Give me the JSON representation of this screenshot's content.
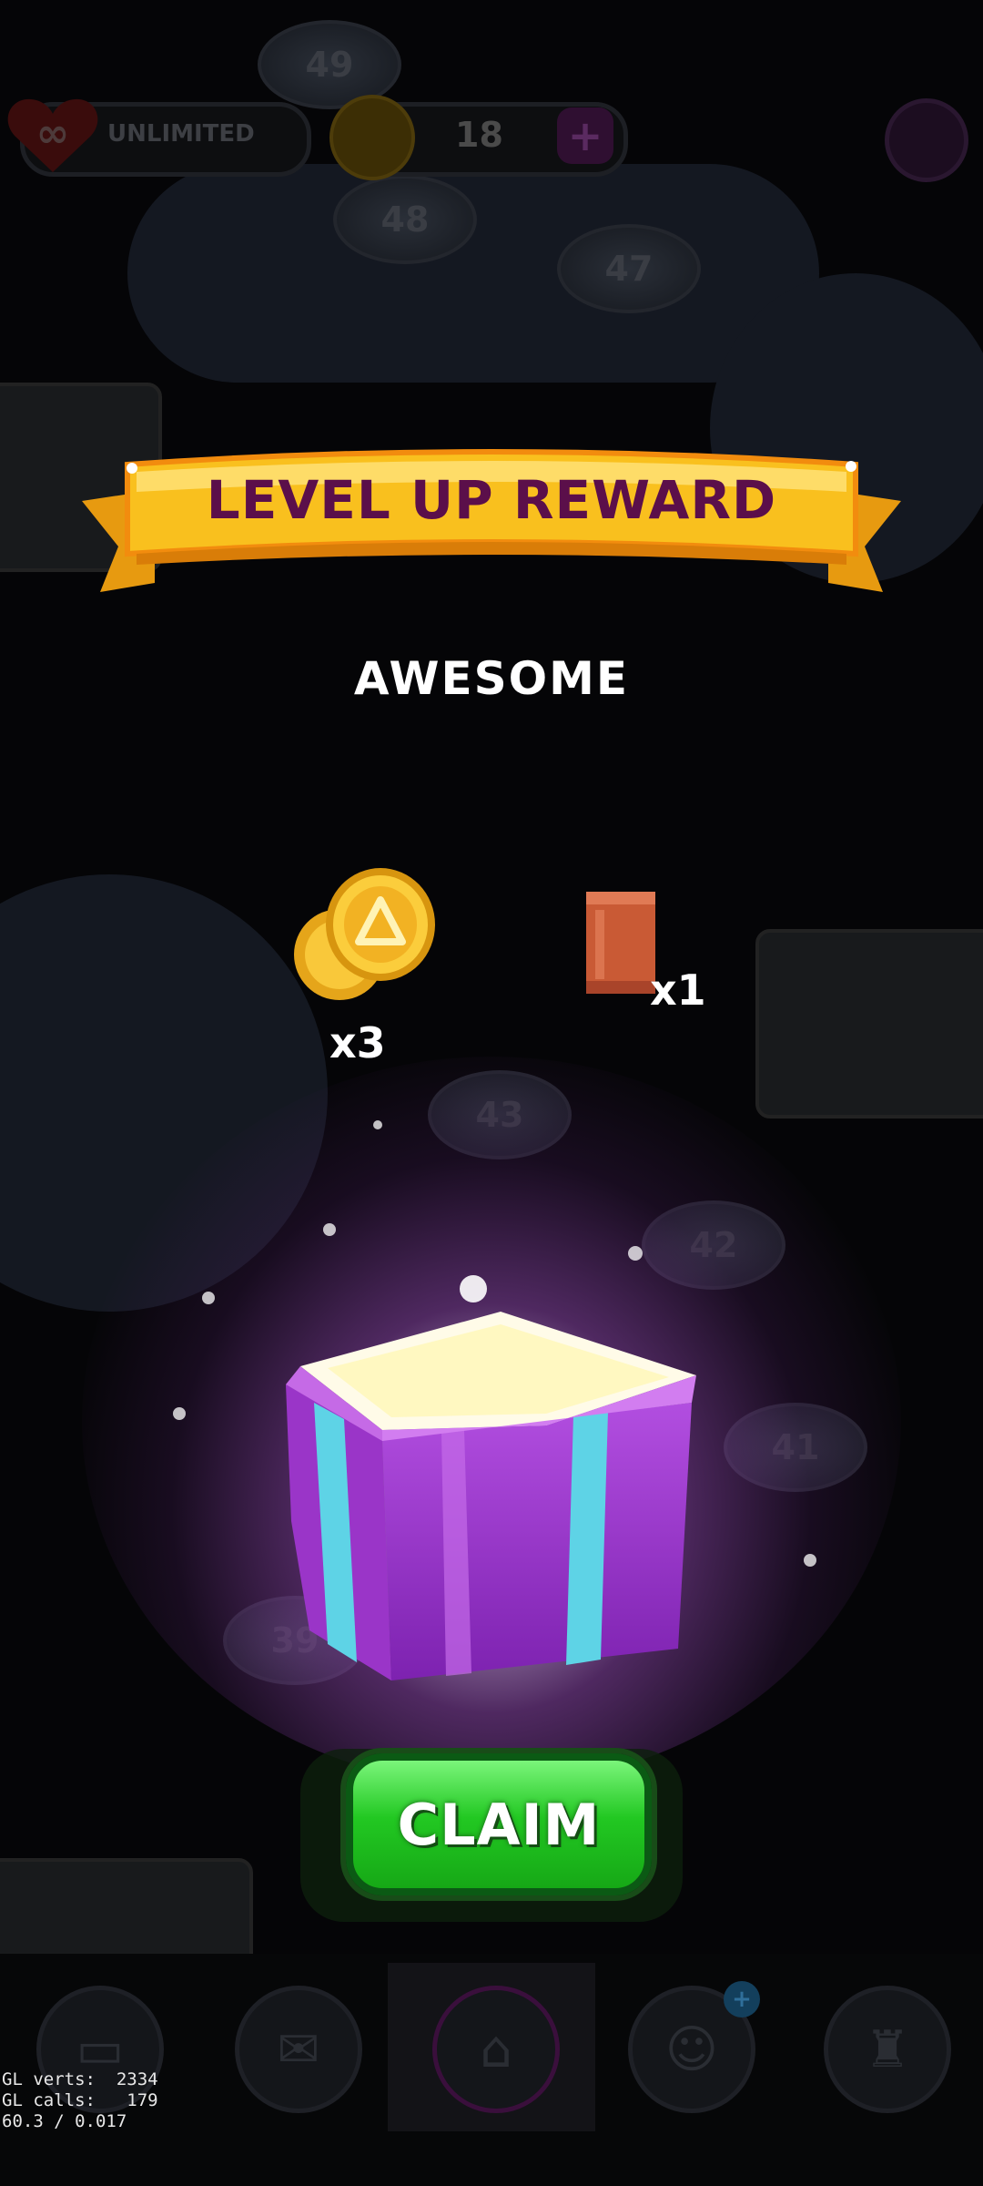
{
  "hud": {
    "lives_label": "UNLIMITED",
    "coins_value": "18",
    "plus_symbol": "+"
  },
  "board": {
    "level_nodes": [
      "49",
      "48",
      "47",
      "43",
      "42",
      "41",
      "39"
    ]
  },
  "reward_panel": {
    "title": "LEVEL UP REWARD",
    "subtitle": "AWESOME",
    "rewards": [
      {
        "icon": "coin-icon",
        "count": "x3"
      },
      {
        "icon": "card-pack-icon",
        "count": "x1"
      }
    ],
    "claim_label": "CLAIM"
  },
  "bottom_nav": {
    "items": [
      "cards-icon",
      "mail-icon",
      "home-icon",
      "friends-icon",
      "trophy-icon"
    ],
    "friends_badge": "+"
  },
  "debug": {
    "line1": "GL verts:  2334",
    "line2": "GL calls:   179",
    "line3": "60.3 / 0.017"
  },
  "colors": {
    "ribbon": "#f9c01e",
    "ribbon_text": "#5b0f4a",
    "claim_green": "#22c822",
    "chest_purple": "#a53fd0",
    "chest_cyan": "#5ed3e6"
  }
}
